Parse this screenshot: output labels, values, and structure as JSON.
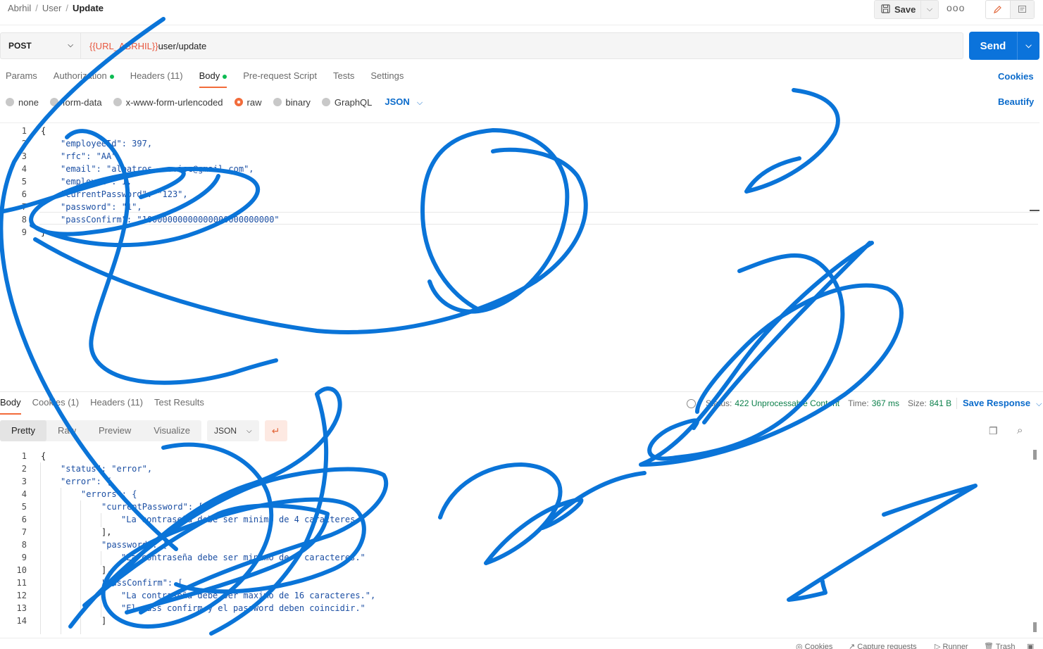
{
  "breadcrumb": {
    "items": [
      "Abrhil",
      "User"
    ],
    "current": "Update"
  },
  "toolbar": {
    "save_label": "Save",
    "more_label": "ooo"
  },
  "request": {
    "method": "POST",
    "url_variable": "{{URL_ABRHIL}}",
    "url_path": "user/update",
    "send_label": "Send"
  },
  "request_tabs": [
    {
      "label": "Params"
    },
    {
      "label": "Authorization"
    },
    {
      "label": "Headers (11)"
    },
    {
      "label": "Body"
    },
    {
      "label": "Pre-request Script"
    },
    {
      "label": "Tests"
    },
    {
      "label": "Settings"
    }
  ],
  "cookies_label": "Cookies",
  "body_types": [
    "none",
    "form-data",
    "x-www-form-urlencoded",
    "raw",
    "binary",
    "GraphQL"
  ],
  "body_type_selected": "raw",
  "body_language": "JSON",
  "beautify_label": "Beautify",
  "request_body": {
    "line_numbers": [
      "1",
      "2",
      "3",
      "4",
      "5",
      "6",
      "7",
      "8",
      "9"
    ],
    "lines": [
      "{",
      "\"employeeId\": 397,",
      "\"rfc\": \"AA\",",
      "\"email\": \"albatros.....isc@gmail.com\",",
      "\"employee\": 1,",
      "\"currentPassword\": \"123\",",
      "\"password\": \"1\",",
      "\"passConfirm\": \"10000000000000000000000000\"",
      "}"
    ]
  },
  "response_tabs": [
    {
      "label": "Body"
    },
    {
      "label": "Cookies (1)"
    },
    {
      "label": "Headers (11)"
    },
    {
      "label": "Test Results"
    }
  ],
  "response_meta": {
    "status_label": "Status:",
    "status_value": "422 Unprocessable Content",
    "time_label": "Time:",
    "time_value": "367 ms",
    "size_label": "Size:",
    "size_value": "841 B",
    "save_response_label": "Save Response"
  },
  "response_views": [
    "Pretty",
    "Raw",
    "Preview",
    "Visualize"
  ],
  "response_format": "JSON",
  "response_body": {
    "line_numbers": [
      "1",
      "2",
      "3",
      "4",
      "5",
      "6",
      "7",
      "8",
      "9",
      "10",
      "11",
      "12",
      "13",
      "14"
    ],
    "lines": [
      "{",
      "\"status\": \"error\",",
      "\"error\": {",
      "\"errors\": {",
      "\"currentPassword\": [",
      "\"La contraseña debe ser minimo de 4 caracteres.\"",
      "],",
      "\"password\": [",
      "\"La contraseña debe ser minimo de 4 caracteres.\"",
      "],",
      "\"passConfirm\": [",
      "\"La contraseña debe ser maximo de 16 caracteres.\",",
      "\"El pass confirm y el password deben coincidir.\"",
      "]"
    ]
  },
  "footer": [
    "Cookies",
    "Capture requests",
    "Runner",
    "Trash"
  ],
  "colors": {
    "accent": "#f26b3a",
    "send": "#0b73db",
    "link": "#0b6bcb",
    "scribble": "#0a74d8"
  }
}
